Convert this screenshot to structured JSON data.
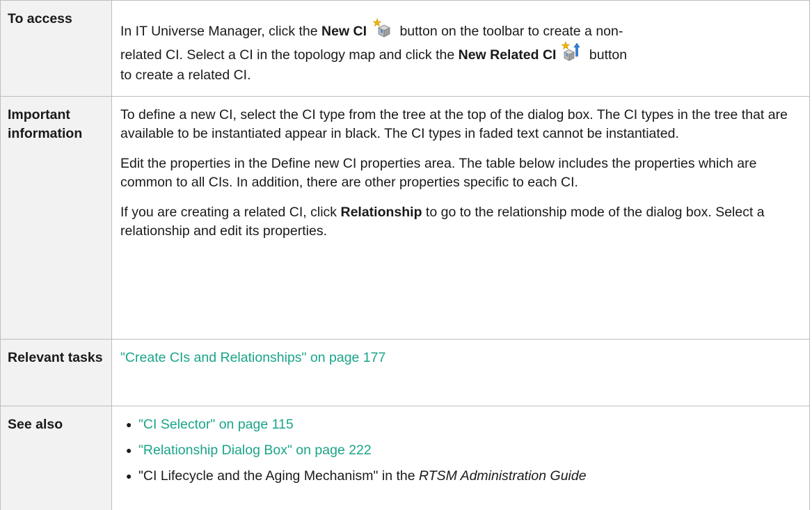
{
  "rows": [
    {
      "label": "To access",
      "line1_pre": "In IT Universe Manager, click the ",
      "line1_bold": "New CI",
      "line1_post": " button on the toolbar to create a non-",
      "line2_pre": "related CI. Select a CI in the topology map and click the ",
      "line2_bold": "New Related CI",
      "line2_post": " button",
      "line3": "to create a related CI.",
      "icon_new_ci": "new-ci-icon",
      "icon_new_related_ci": "new-related-ci-icon"
    },
    {
      "label": "Important information",
      "para1": "To define a new CI, select the CI type from the tree at the top of the dialog box. The CI types in the tree that are available to be instantiated appear in black. The CI types in faded text cannot be instantiated.",
      "para2": "Edit the properties in the Define new CI properties area. The table below includes the properties which are common to all CIs. In addition, there are other properties specific to each CI.",
      "para3_pre": "If you are creating a related CI, click ",
      "para3_bold": "Relationship",
      "para3_post": " to go to the relationship mode of the dialog box. Select a relationship and edit its properties."
    },
    {
      "label": "Relevant tasks",
      "link": "\"Create CIs and Relationships\" on page 177"
    },
    {
      "label": "See also",
      "links": [
        "\"CI Selector\" on page 115",
        "\"Relationship Dialog Box\" on page 222"
      ],
      "plain_pre": "\"CI Lifecycle and the Aging Mechanism\" in the ",
      "plain_italic": "RTSM Administration Guide"
    }
  ],
  "colors": {
    "link": "#1aa489",
    "label_bg": "#f2f2f2",
    "border": "#bdbdbd"
  }
}
